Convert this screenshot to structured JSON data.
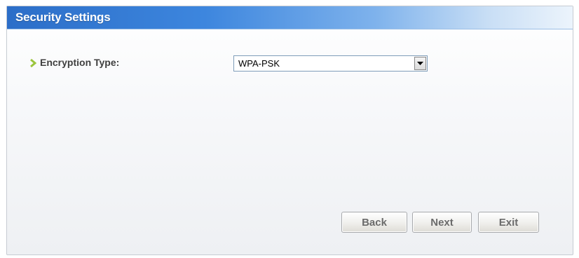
{
  "window": {
    "title": "Security Settings"
  },
  "form": {
    "encryption_label": "Encryption Type:",
    "encryption_value": "WPA-PSK"
  },
  "buttons": {
    "back": "Back",
    "next": "Next",
    "exit": "Exit"
  },
  "colors": {
    "title_bar_start": "#2c6ec8",
    "title_bar_end": "#ecf4fc",
    "bullet": "#9bc53d"
  },
  "icons": {
    "bullet": "chevron-right-icon",
    "dropdown": "dropdown-arrow-icon"
  }
}
